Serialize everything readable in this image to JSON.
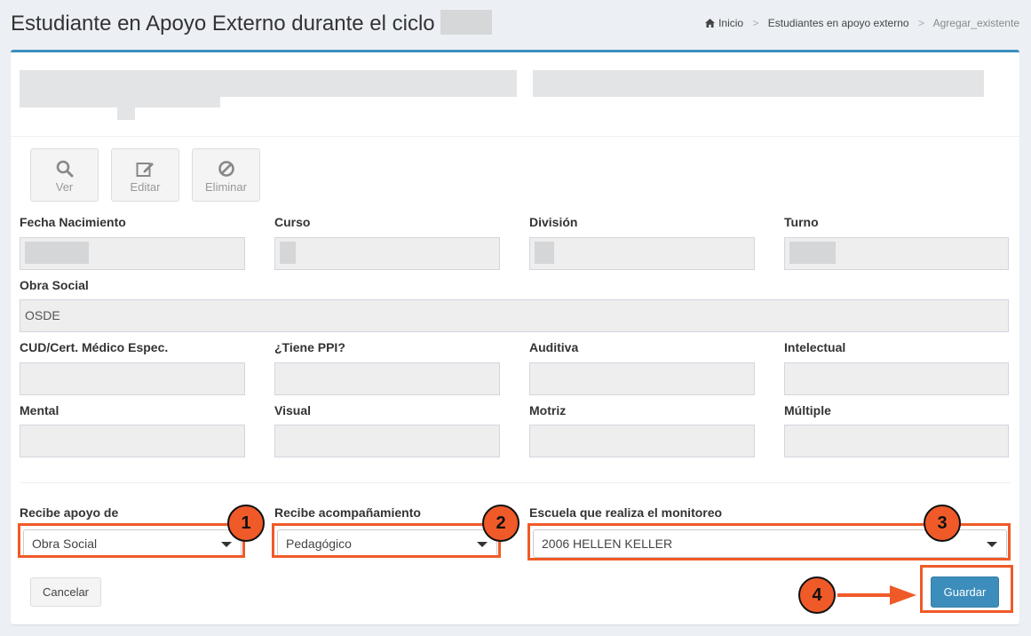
{
  "header": {
    "title": "Estudiante en Apoyo Externo durante el ciclo",
    "breadcrumb": [
      "Inicio",
      "Estudiantes en apoyo externo",
      "Agregar_existente"
    ]
  },
  "actions": {
    "view": "Ver",
    "edit": "Editar",
    "delete": "Eliminar"
  },
  "fields": {
    "fecha_nacimiento": {
      "label": "Fecha Nacimiento",
      "value": ""
    },
    "curso": {
      "label": "Curso",
      "value": ""
    },
    "division": {
      "label": "División",
      "value": ""
    },
    "turno": {
      "label": "Turno",
      "value": ""
    },
    "obra_social": {
      "label": "Obra Social",
      "value": "OSDE"
    },
    "cud": {
      "label": "CUD/Cert. Médico Espec.",
      "value": ""
    },
    "ppi": {
      "label": "¿Tiene PPI?",
      "value": ""
    },
    "auditiva": {
      "label": "Auditiva",
      "value": ""
    },
    "intelectual": {
      "label": "Intelectual",
      "value": ""
    },
    "mental": {
      "label": "Mental",
      "value": ""
    },
    "visual": {
      "label": "Visual",
      "value": ""
    },
    "motriz": {
      "label": "Motriz",
      "value": ""
    },
    "multiple": {
      "label": "Múltiple",
      "value": ""
    }
  },
  "selects": {
    "apoyo": {
      "label": "Recibe apoyo de",
      "value": "Obra Social"
    },
    "acompanamiento": {
      "label": "Recibe acompañamiento",
      "value": "Pedagógico"
    },
    "escuela": {
      "label": "Escuela que realiza el monitoreo",
      "value": "2006 HELLEN KELLER"
    }
  },
  "buttons": {
    "cancel": "Cancelar",
    "save": "Guardar"
  },
  "annotations": [
    "1",
    "2",
    "3",
    "4"
  ],
  "colors": {
    "accent": "#3c8dbc",
    "highlight": "#f05a28",
    "background": "#ecf0f5"
  },
  "icons": [
    "home-icon",
    "search-icon",
    "edit-icon",
    "ban-icon",
    "caret-down-icon"
  ]
}
